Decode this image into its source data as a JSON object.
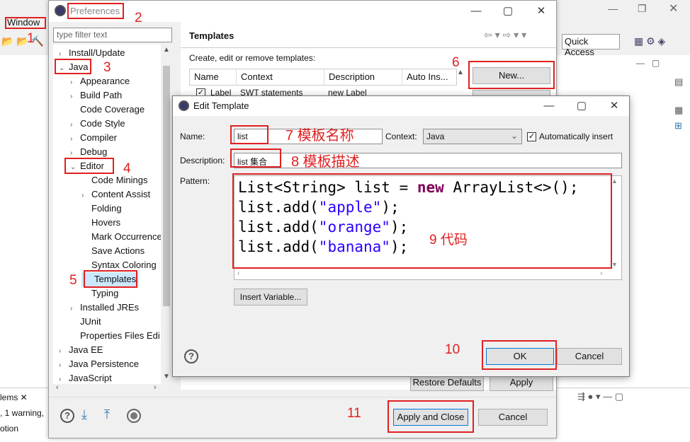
{
  "ide": {
    "window_menu": "Window",
    "quick_access": "Quick Access",
    "problems_tab": "lems",
    "problems_summary": ", 1 warning,",
    "problems_desc": "otion"
  },
  "preferences": {
    "title": "Preferences",
    "filter_placeholder": "type filter text",
    "tree": [
      {
        "label": "Install/Update",
        "arrow": "›",
        "indent": 0
      },
      {
        "label": "Java",
        "arrow": "⌄",
        "indent": 0
      },
      {
        "label": "Appearance",
        "arrow": "›",
        "indent": 1
      },
      {
        "label": "Build Path",
        "arrow": "›",
        "indent": 1
      },
      {
        "label": "Code Coverage",
        "arrow": "",
        "indent": 1
      },
      {
        "label": "Code Style",
        "arrow": "›",
        "indent": 1
      },
      {
        "label": "Compiler",
        "arrow": "›",
        "indent": 1
      },
      {
        "label": "Debug",
        "arrow": "›",
        "indent": 1
      },
      {
        "label": "Editor",
        "arrow": "⌄",
        "indent": 1
      },
      {
        "label": "Code Minings",
        "arrow": "",
        "indent": 2
      },
      {
        "label": "Content Assist",
        "arrow": "›",
        "indent": 2
      },
      {
        "label": "Folding",
        "arrow": "",
        "indent": 2
      },
      {
        "label": "Hovers",
        "arrow": "",
        "indent": 2
      },
      {
        "label": "Mark Occurrence",
        "arrow": "",
        "indent": 2
      },
      {
        "label": "Save Actions",
        "arrow": "",
        "indent": 2
      },
      {
        "label": "Syntax Coloring",
        "arrow": "",
        "indent": 2
      },
      {
        "label": "Templates",
        "arrow": "",
        "indent": 2
      },
      {
        "label": "Typing",
        "arrow": "",
        "indent": 2
      },
      {
        "label": "Installed JREs",
        "arrow": "›",
        "indent": 1
      },
      {
        "label": "JUnit",
        "arrow": "",
        "indent": 1
      },
      {
        "label": "Properties Files Edi",
        "arrow": "",
        "indent": 1
      },
      {
        "label": "Java EE",
        "arrow": "›",
        "indent": 0
      },
      {
        "label": "Java Persistence",
        "arrow": "›",
        "indent": 0
      },
      {
        "label": "JavaScript",
        "arrow": "›",
        "indent": 0
      }
    ],
    "page_title": "Templates",
    "page_desc": "Create, edit or remove templates:",
    "columns": [
      "Name",
      "Context",
      "Description",
      "Auto Ins..."
    ],
    "row": {
      "name": "Label",
      "context": "SWT statements",
      "desc": "new Label"
    },
    "new_button": "New...",
    "restore_defaults": "Restore Defaults",
    "apply": "Apply",
    "apply_close": "Apply and Close",
    "cancel": "Cancel"
  },
  "dialog": {
    "title": "Edit Template",
    "name_label": "Name:",
    "name_value": "list",
    "context_label": "Context:",
    "context_value": "Java",
    "auto_insert_label": "Automatically insert",
    "description_label": "Description:",
    "description_value": "list 集合",
    "pattern_label": "Pattern:",
    "insert_variable": "Insert Variable...",
    "ok": "OK",
    "cancel": "Cancel"
  },
  "code_lines": [
    {
      "a": "List<String> list = ",
      "kw": "new",
      "b": " ArrayList<>();",
      "str": "",
      "c": ""
    },
    {
      "a": "list.add(",
      "kw": "",
      "b": "",
      "str": "\"apple\"",
      "c": ");"
    },
    {
      "a": "list.add(",
      "kw": "",
      "b": "",
      "str": "\"orange\"",
      "c": ");"
    },
    {
      "a": "list.add(",
      "kw": "",
      "b": "",
      "str": "\"banana\"",
      "c": ");"
    }
  ],
  "annotations": {
    "n1": "1",
    "n2": "2",
    "n3": "3",
    "n4": "4",
    "n5": "5",
    "n6": "6",
    "n7": "7 模板名称",
    "n8": "8 模板描述",
    "n9": "9 代码",
    "n10": "10",
    "n11": "11"
  },
  "colors": {
    "annotation": "#e02020",
    "keyword": "#7f0055",
    "string": "#2a00ff"
  }
}
